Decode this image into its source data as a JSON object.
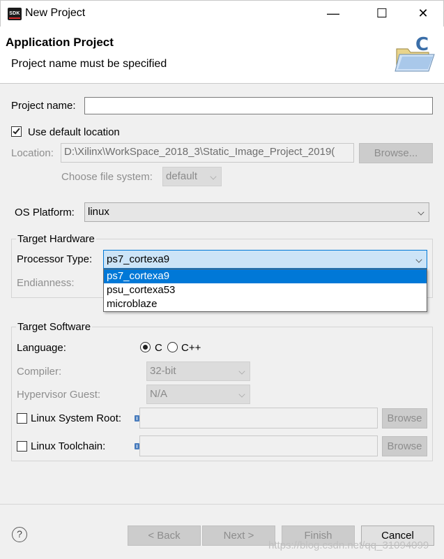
{
  "window": {
    "title": "New Project",
    "app_badge": "SDK",
    "minimize_glyph": "—",
    "maximize_glyph": "☐",
    "close_glyph": "✕"
  },
  "header": {
    "title": "Application Project",
    "message": "Project name must be specified"
  },
  "form": {
    "project_name_label": "Project name:",
    "project_name_value": "",
    "use_default_location_label": "Use default location",
    "use_default_location_checked": true,
    "location_label": "Location:",
    "location_value": "D:\\Xilinx\\WorkSpace_2018_3\\Static_Image_Project_2019(",
    "browse_label": "Browse...",
    "choose_fs_label": "Choose file system:",
    "choose_fs_value": "default",
    "os_platform_label": "OS Platform:",
    "os_platform_value": "linux"
  },
  "target_hardware": {
    "group_title": "Target Hardware",
    "processor_type_label": "Processor Type:",
    "processor_type_value": "ps7_cortexa9",
    "endianness_label": "Endianness:",
    "processor_options": [
      "ps7_cortexa9",
      "psu_cortexa53",
      "microblaze"
    ]
  },
  "target_software": {
    "group_title": "Target Software",
    "language_label": "Language:",
    "lang_c": "C",
    "lang_cpp": "C++",
    "compiler_label": "Compiler:",
    "compiler_value": "32-bit",
    "hypervisor_label": "Hypervisor Guest:",
    "hypervisor_value": "N/A",
    "linux_sysroot_label": "Linux System Root:",
    "linux_toolchain_label": "Linux Toolchain:",
    "browse_label": "Browse"
  },
  "footer": {
    "help_glyph": "?",
    "back_label": "< Back",
    "next_label": "Next >",
    "finish_label": "Finish",
    "cancel_label": "Cancel"
  },
  "watermark": "https://blog.csdn.net/qq_31094099",
  "colors": {
    "selection": "#0078d7",
    "accent": "#4a7dbd"
  }
}
